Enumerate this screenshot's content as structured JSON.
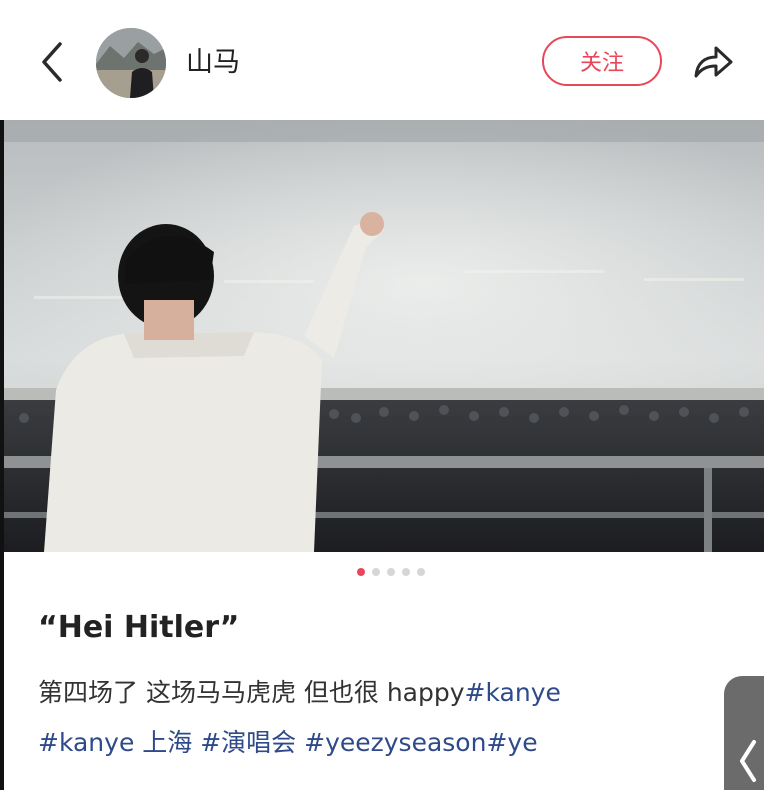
{
  "header": {
    "back_icon": "chevron-left-icon",
    "username": "山马",
    "follow_label": "关注",
    "share_icon": "share-arrow-icon"
  },
  "carousel": {
    "image_description_hidden": true,
    "page_count": 5,
    "active_index": 0
  },
  "post": {
    "title": "“Hei Hitler”",
    "body_line1_text": "第四场了 这场马马虎虎 但也很 happy",
    "body_line1_tag": "#kanye",
    "body_line2": [
      {
        "text": "#kanye 上海",
        "kind": "tag"
      },
      {
        "text": " #演唱会",
        "kind": "tag"
      },
      {
        "text": " #yeezyseason",
        "kind": "tag"
      },
      {
        "text": "#ye",
        "kind": "tag"
      }
    ]
  },
  "colors": {
    "accent": "#e8475a",
    "tag": "#2e4a8a",
    "dot_inactive": "#d6d6d6"
  }
}
